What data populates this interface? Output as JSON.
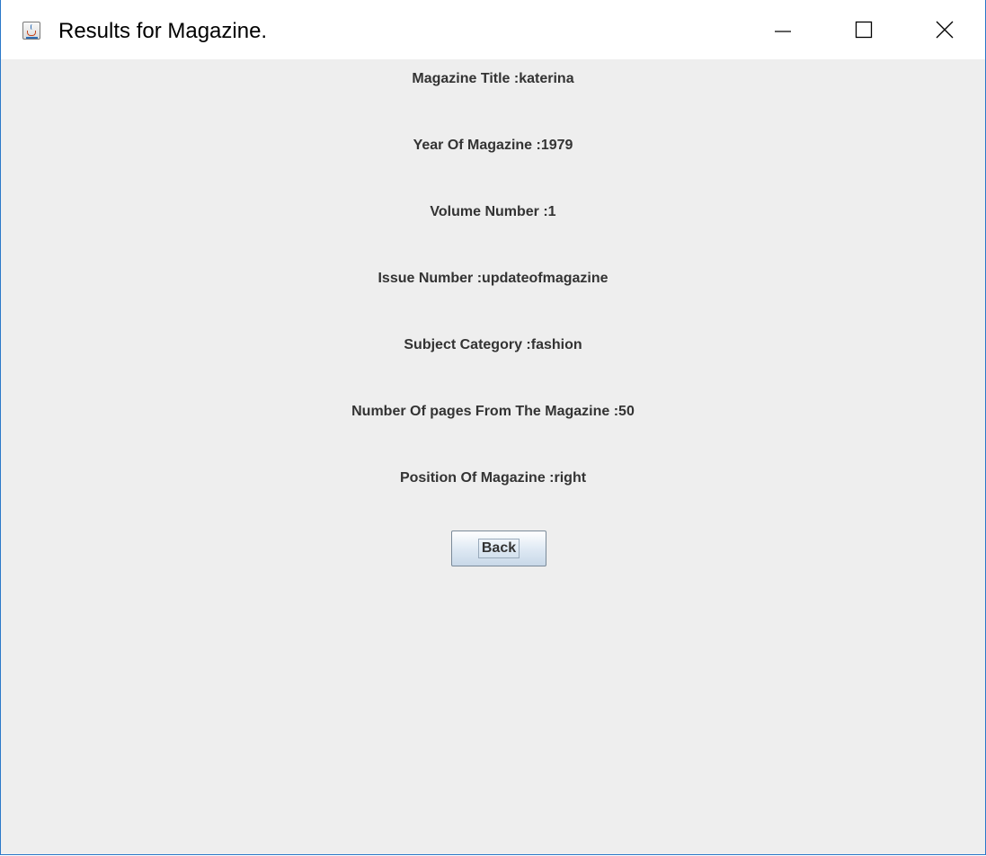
{
  "window": {
    "title": "Results for Magazine.",
    "icon": "java-cup-icon",
    "controls": {
      "minimize": "minimize-icon",
      "maximize": "maximize-icon",
      "close": "close-icon"
    }
  },
  "fields": [
    {
      "text": "Magazine Title :katerina"
    },
    {
      "text": "Year Of Magazine :1979"
    },
    {
      "text": "Volume Number :1"
    },
    {
      "text": "Issue Number :updateofmagazine"
    },
    {
      "text": "Subject Category :fashion"
    },
    {
      "text": "Number Of pages From The Magazine :50"
    },
    {
      "text": "Position Of Magazine :right"
    }
  ],
  "actions": {
    "back_label": "Back"
  },
  "colors": {
    "window_border": "#2b79c9",
    "content_background": "#eeeeee",
    "label_text": "#333333"
  }
}
